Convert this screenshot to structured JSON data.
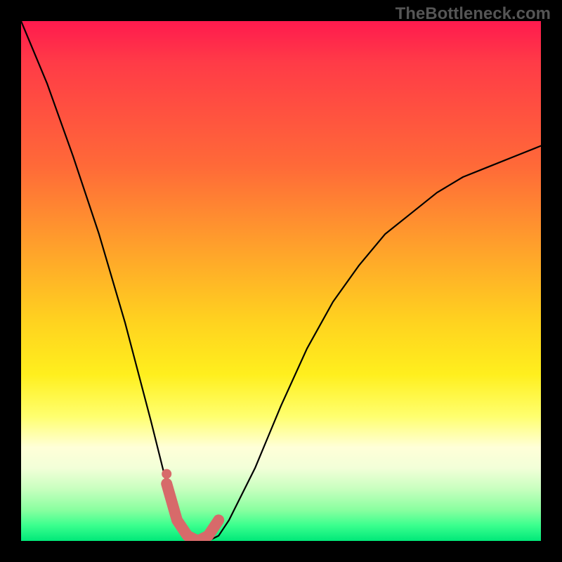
{
  "watermark": "TheBottleneck.com",
  "chart_data": {
    "type": "line",
    "title": "",
    "xlabel": "",
    "ylabel": "",
    "xlim": [
      0,
      100
    ],
    "ylim": [
      0,
      100
    ],
    "series": [
      {
        "name": "bottleneck-curve",
        "x": [
          0,
          5,
          10,
          15,
          20,
          25,
          28,
          30,
          32,
          34,
          36,
          38,
          40,
          45,
          50,
          55,
          60,
          65,
          70,
          75,
          80,
          85,
          90,
          95,
          100
        ],
        "values": [
          100,
          88,
          74,
          59,
          42,
          23,
          11,
          4,
          1,
          0,
          0,
          1,
          4,
          14,
          26,
          37,
          46,
          53,
          59,
          63,
          67,
          70,
          72,
          74,
          76
        ]
      }
    ],
    "marker_region": {
      "name": "bottleneck-range",
      "color": "#d76a6a",
      "x": [
        28,
        30,
        32,
        34,
        36,
        38
      ],
      "values": [
        11,
        4,
        1,
        0,
        1,
        4
      ]
    },
    "background_gradient": [
      "#ff1a4e",
      "#ff6a38",
      "#ffd31f",
      "#ffff6e",
      "#c8ffbf",
      "#00e879"
    ]
  }
}
